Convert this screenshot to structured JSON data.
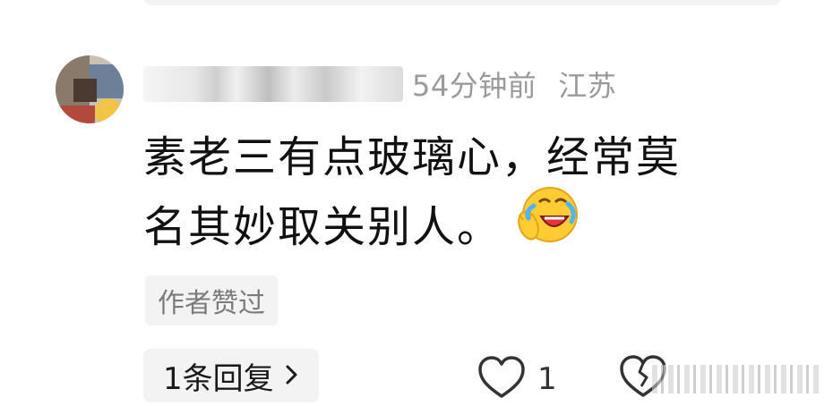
{
  "comment": {
    "meta": {
      "time_ago": "54分钟前",
      "location": "江苏"
    },
    "text_line1": "素老三有点玻璃心，经常莫",
    "text_line2": "名其妙取关别人。",
    "emoji": "laughing-crying-emoji",
    "author_badge": "作者赞过",
    "reply_label": "1条回复",
    "like_count": "1"
  },
  "icons": {
    "reply_chevron": "chevron-right-icon",
    "like": "heart-outline-icon",
    "dislike": "broken-heart-outline-icon"
  },
  "colors": {
    "background": "#ffffff",
    "meta_text": "#9a9a9a",
    "comment_text": "#111111",
    "chip_background": "#f3f3f3",
    "badge_text": "#7b7b7b"
  }
}
